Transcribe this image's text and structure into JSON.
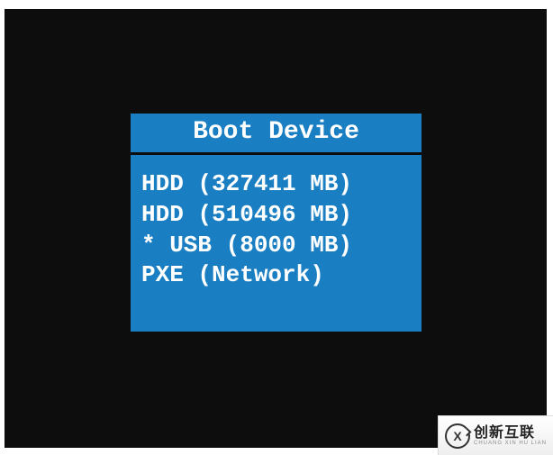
{
  "boot_menu": {
    "title": "Boot Device",
    "items": [
      {
        "label": "HDD (327411 MB)",
        "selected": false
      },
      {
        "label": "HDD (510496 MB)",
        "selected": false
      },
      {
        "label": "* USB (8000 MB)",
        "selected": true
      },
      {
        "label": "PXE (Network)",
        "selected": false
      }
    ]
  },
  "watermark": {
    "logo_letter": "X",
    "main": "创新互联",
    "sub": "CHUANG XIN HU LIAN"
  }
}
